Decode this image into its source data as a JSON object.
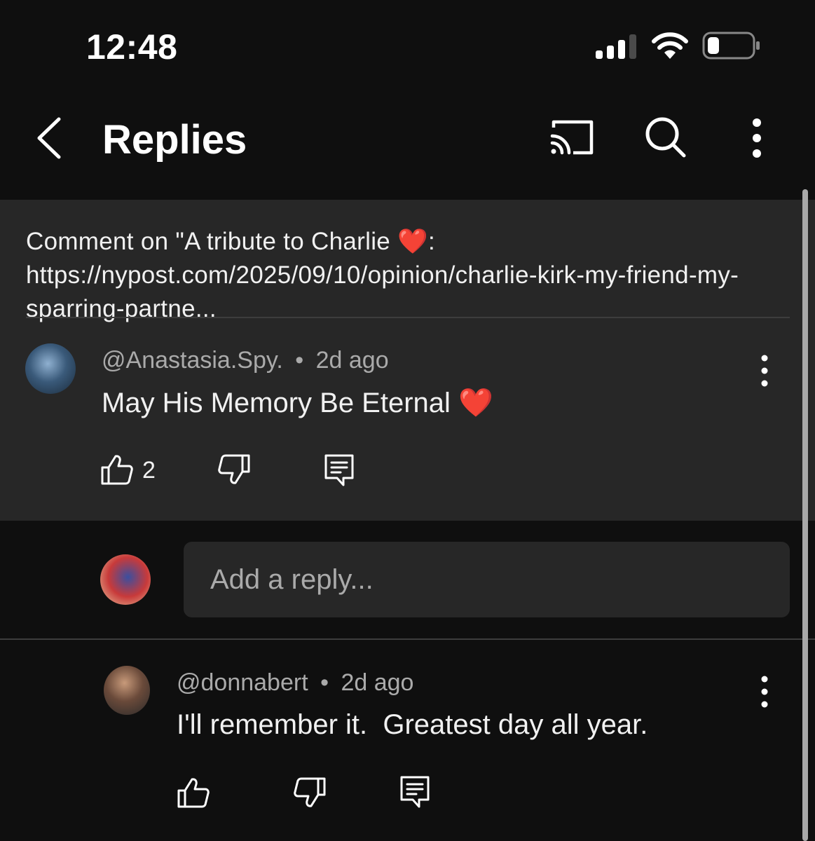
{
  "status_bar": {
    "time": "12:48"
  },
  "header": {
    "title": "Replies"
  },
  "parent_comment": {
    "context_text": "Comment on \"A tribute to Charlie ❤️: https://nypost.com/2025/09/10/opinion/charlie-kirk-my-friend-my-sparring-partne...",
    "author": "@Anastasia.Spy.",
    "separator": "•",
    "time": "2d ago",
    "text": "May His Memory Be Eternal ❤️",
    "like_count": "2"
  },
  "reply_box": {
    "placeholder": "Add a reply..."
  },
  "replies": [
    {
      "author": "@donnabert",
      "separator": "•",
      "time": "2d ago",
      "text": "I'll remember it.  Greatest day all year."
    }
  ],
  "icons": {
    "back": "back-arrow-icon",
    "cast": "cast-icon",
    "search": "search-icon",
    "more": "more-vertical-icon",
    "like": "thumbs-up-icon",
    "dislike": "thumbs-down-icon",
    "reply": "reply-icon"
  },
  "colors": {
    "background": "#0f0f0f",
    "card": "#272727",
    "text_primary": "#f1f1f1",
    "text_secondary": "#aaaaaa",
    "heart": "#e0242e"
  }
}
